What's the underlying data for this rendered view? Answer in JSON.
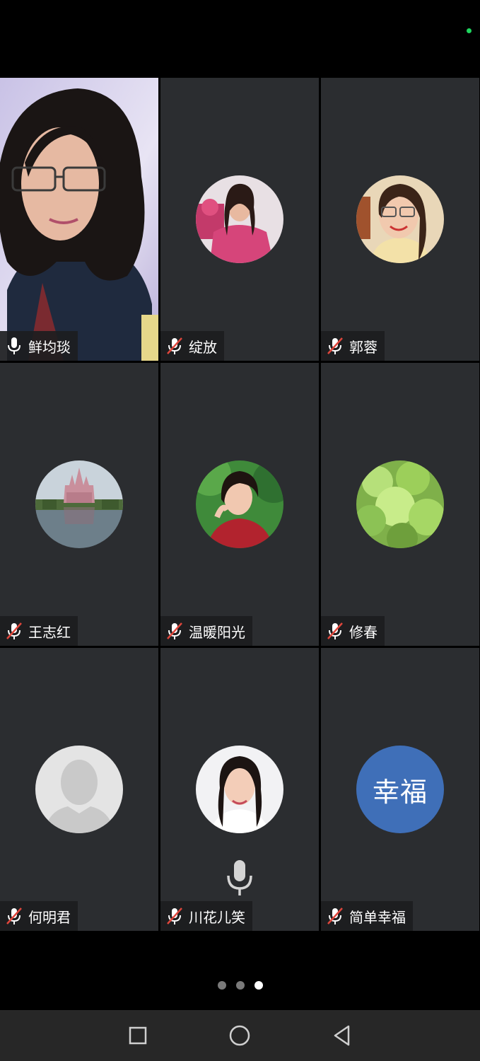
{
  "status": {
    "indicator_color": "#1fd65f"
  },
  "participants": [
    {
      "name": "鲜均琰",
      "mic": "on",
      "avatar": "video"
    },
    {
      "name": "绽放",
      "mic": "muted",
      "avatar": "photo-woman-pink"
    },
    {
      "name": "郭蓉",
      "mic": "muted",
      "avatar": "photo-woman-glasses"
    },
    {
      "name": "王志红",
      "mic": "muted",
      "avatar": "photo-castle"
    },
    {
      "name": "温暖阳光",
      "mic": "muted",
      "avatar": "photo-woman-red"
    },
    {
      "name": "修春",
      "mic": "muted",
      "avatar": "photo-leaves"
    },
    {
      "name": "何明君",
      "mic": "muted",
      "avatar": "default-silhouette"
    },
    {
      "name": "川花儿笑",
      "mic": "muted",
      "avatar": "photo-woman-white"
    },
    {
      "name": "简单幸福",
      "mic": "muted",
      "avatar": "text",
      "avatar_text": "幸福",
      "avatar_color": "#3f6fb8"
    }
  ],
  "pagination": {
    "total": 3,
    "active": 3
  },
  "icons": {
    "mic_on": "microphone-icon",
    "mic_muted": "microphone-muted-icon",
    "speaking": "microphone-speaking-icon"
  },
  "navbar": {
    "recent": "square-icon",
    "home": "circle-icon",
    "back": "triangle-back-icon"
  }
}
